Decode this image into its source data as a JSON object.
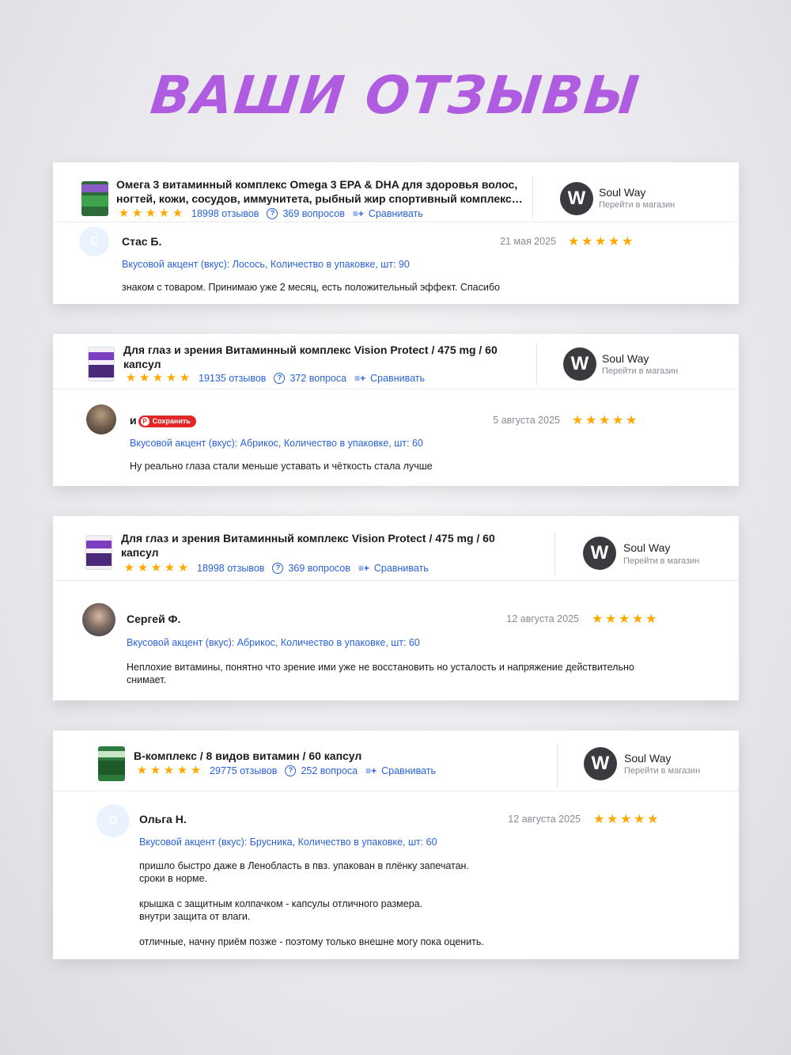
{
  "page": {
    "title": "ВАШИ ОТЗЫВЫ"
  },
  "colors": {
    "title": "#b05ce0",
    "link": "#2a63d8",
    "star": "#ffa800",
    "save_badge": "#e32626"
  },
  "icons": {
    "star": "star-icon",
    "questions": "question-bubble-icon",
    "compare": "compare-icon",
    "shop": "soul-way-logo-icon",
    "save": "pinterest-save-icon"
  },
  "reviews": [
    {
      "product_title": "Омега 3 витаминный комплекс Omega 3 EPA & DHA для здоровья волос, ногтей, кожи, сосудов, иммунитета, рыбный жир спортивный комплекс…",
      "reviews_count": "18998 отзывов",
      "questions_count": "369 вопросов",
      "compare": "Сравнивать",
      "shop_name": "Soul Way",
      "shop_link": "Перейти в магазин",
      "author": "Стас Б.",
      "avatar_letter": "С",
      "date": "21 мая 2025",
      "rating": 5,
      "variant": "Вкусовой акцент (вкус): Лосось, Количество в упаковке, шт: 90",
      "text": "знаком с товаром. Принимаю уже 2 месяц, есть положительный эффект. Спасибо"
    },
    {
      "product_title": "Для глаз и зрения Витаминный комплекс Vision Protect / 475 mg / 60 капсул",
      "reviews_count": "19135 отзывов",
      "questions_count": "372 вопроса",
      "compare": "Сравнивать",
      "shop_name": "Soul Way",
      "shop_link": "Перейти в магазин",
      "author": "и",
      "save_label": "Сохранить",
      "date": "5 августа 2025",
      "rating": 5,
      "variant": "Вкусовой акцент (вкус): Абрикос, Количество в упаковке, шт: 60",
      "text": "Ну реально глаза стали меньше уставать и чёткость стала лучше"
    },
    {
      "product_title": "Для глаз и зрения Витаминный комплекс Vision Protect / 475 mg / 60 капсул",
      "reviews_count": "18998 отзывов",
      "questions_count": "369 вопросов",
      "compare": "Сравнивать",
      "shop_name": "Soul Way",
      "shop_link": "Перейти в магазин",
      "author": "Сергей Ф.",
      "date": "12 августа 2025",
      "rating": 5,
      "variant": "Вкусовой акцент (вкус): Абрикос, Количество в упаковке, шт: 60",
      "text": "Неплохие витамины, понятно что зрение ими уже не восстановить но усталость и напряжение действительно снимает."
    },
    {
      "product_title": "B-комплекс / 8 видов витамин / 60 капсул",
      "reviews_count": "29775 отзывов",
      "questions_count": "252 вопроса",
      "compare": "Сравнивать",
      "shop_name": "Soul Way",
      "shop_link": "Перейти в магазин",
      "author": "Ольга Н.",
      "avatar_letter": "О",
      "date": "12 августа 2025",
      "rating": 5,
      "variant": "Вкусовой акцент (вкус): Брусника, Количество в упаковке, шт: 60",
      "text": "пришло быстро даже в Ленобласть в пвз. упакован в плёнку запечатан.\nсроки в норме.\n\nкрышка с защитным колпачком - капсулы отличного размера.\nвнутри защита от влаги.\n\nотличные, начну приём позже - поэтому только внешне могу пока оценить."
    }
  ]
}
